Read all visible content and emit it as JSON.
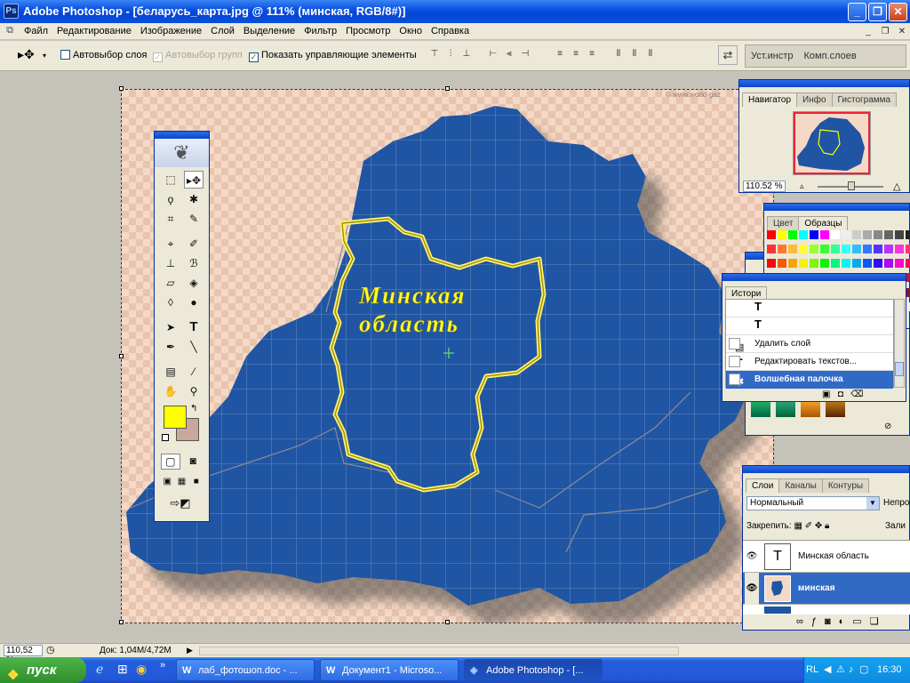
{
  "window": {
    "title": "Adobe Photoshop - [беларусь_карта.jpg @ 111% (минская, RGB/8#)]"
  },
  "menu": [
    "Файл",
    "Редактирование",
    "Изображение",
    "Слой",
    "Выделение",
    "Фильтр",
    "Просмотр",
    "Окно",
    "Справка"
  ],
  "options": {
    "auto_select_layer": "Автовыбор слоя",
    "auto_select_groups": "Автовыбор групп",
    "show_controls": "Показать управляющие элементы",
    "auto_select_layer_checked": false,
    "show_controls_checked": true
  },
  "well": {
    "brushes_tab": "Уст.инстр",
    "comps_tab": "Комп.слоев"
  },
  "canvas": {
    "label_line1": "Минская",
    "label_line2": "область",
    "watermark": "© www.world-gaz"
  },
  "navigator": {
    "tabs": [
      "Навигатор",
      "Инфо",
      "Гистограмма"
    ],
    "zoom": "110.52 %"
  },
  "color_palette": {
    "tabs": [
      "Цвет",
      "Образцы"
    ]
  },
  "history": {
    "tab": "Истори",
    "items": [
      "Удалить слой",
      "Редактировать текстов...",
      "Волшебная палочка"
    ],
    "active_index": 2
  },
  "layers": {
    "tabs": [
      "Слои",
      "Каналы",
      "Контуры"
    ],
    "blend_mode": "Нормальный",
    "opacity_label": "Непро",
    "lock_label": "Закрепить:",
    "fill_label": "Зали",
    "items": [
      {
        "name": "Минская область",
        "type": "T"
      },
      {
        "name": "минская",
        "type": "image",
        "selected": true
      }
    ]
  },
  "status": {
    "zoom": "110,52 %",
    "doc": "Док: 1,04M/4,72M"
  },
  "taskbar": {
    "start": "пуск",
    "buttons": [
      "лаб_фотошоп.doc - ...",
      "Документ1 - Microso...",
      "Adobe Photoshop - [..."
    ],
    "lang": "RL",
    "time": "16:30"
  },
  "colors": {
    "foreground": "#ffff00",
    "background": "#c8a89a",
    "map": "#1f55a3",
    "titlebar": "#0a52e2"
  }
}
